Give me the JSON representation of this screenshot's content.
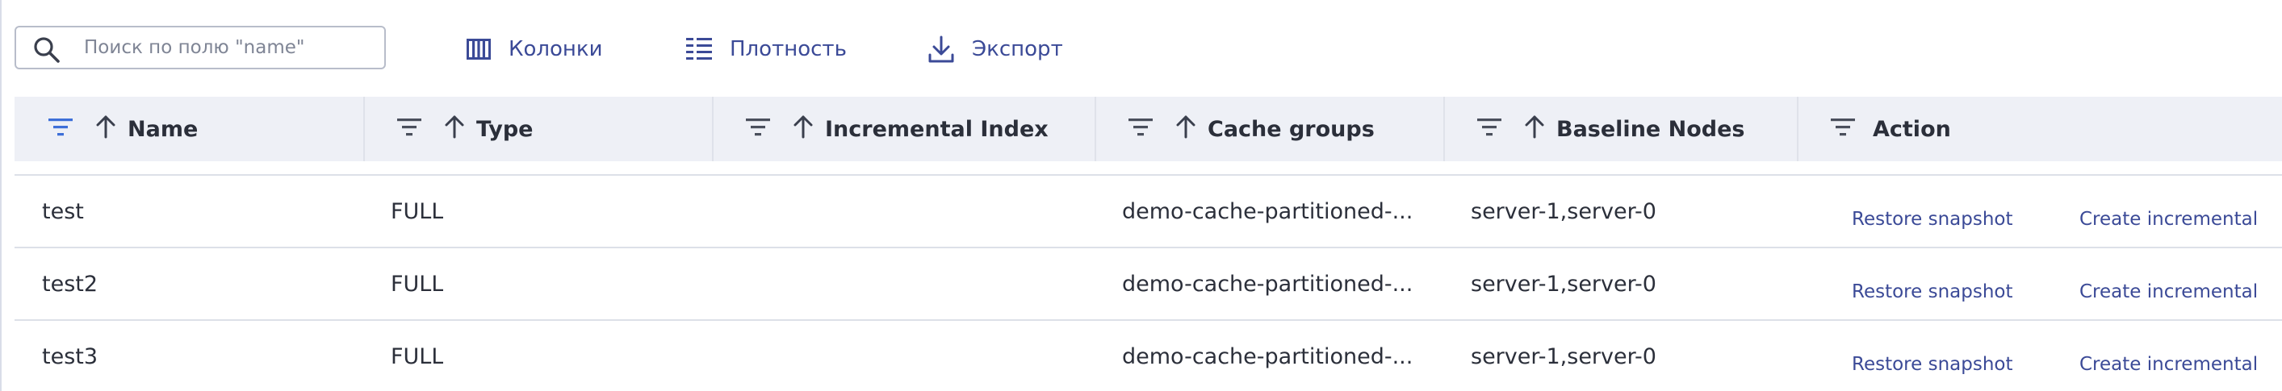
{
  "toolbar": {
    "search": {
      "placeholder": "Поиск по полю \"name\"",
      "value": ""
    },
    "columns_label": "Колонки",
    "density_label": "Плотность",
    "export_label": "Экспорт"
  },
  "table": {
    "columns": [
      {
        "key": "name",
        "label": "Name",
        "sortable": true
      },
      {
        "key": "type",
        "label": "Type",
        "sortable": true
      },
      {
        "key": "incremental_index",
        "label": "Incremental Index",
        "sortable": true
      },
      {
        "key": "cache_groups",
        "label": "Cache groups",
        "sortable": true
      },
      {
        "key": "baseline_nodes",
        "label": "Baseline Nodes",
        "sortable": true
      },
      {
        "key": "action",
        "label": "Action",
        "sortable": false
      }
    ],
    "rows": [
      {
        "name": "test",
        "type": "FULL",
        "incremental_index": "",
        "cache_groups": "demo-cache-partitioned-...",
        "baseline_nodes": "server-1,server-0",
        "actions": [
          "Restore snapshot",
          "Create incremental"
        ]
      },
      {
        "name": "test2",
        "type": "FULL",
        "incremental_index": "",
        "cache_groups": "demo-cache-partitioned-...",
        "baseline_nodes": "server-1,server-0",
        "actions": [
          "Restore snapshot",
          "Create incremental"
        ]
      },
      {
        "name": "test3",
        "type": "FULL",
        "incremental_index": "",
        "cache_groups": "demo-cache-partitioned-...",
        "baseline_nodes": "server-1,server-0",
        "actions": [
          "Restore snapshot",
          "Create incremental"
        ]
      }
    ]
  },
  "colors": {
    "accent": "#3b4a97",
    "active_filter": "#3d6fd8",
    "header_bg": "#eef0f6",
    "border": "#dde0e8",
    "text": "#2b2f3a"
  },
  "icons": {
    "search": "search-icon",
    "columns": "columns-icon",
    "density": "density-icon",
    "export": "download-icon",
    "filter": "filter-icon",
    "sort": "arrow-up-icon"
  }
}
